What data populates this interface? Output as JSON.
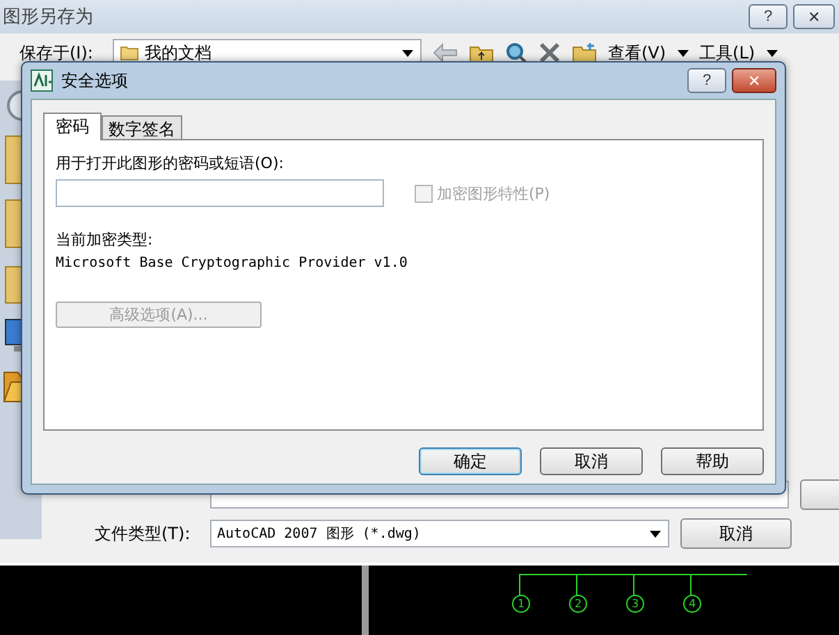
{
  "window": {
    "title": "图形另存为",
    "buttons": [
      {
        "kind": "help",
        "label": "?"
      },
      {
        "kind": "close",
        "label": "✕"
      }
    ]
  },
  "toolbar": {
    "save_in_label": "保存于(I):",
    "location": "我的文档",
    "view_menu": "查看(V)",
    "tools_menu": "工具(L)"
  },
  "file_type": {
    "label": "文件类型(T):",
    "value": "AutoCAD 2007 图形 (*.dwg)"
  },
  "cancel_button": "取消",
  "drawing_markers": [
    "1",
    "2",
    "3",
    "4"
  ],
  "dialog": {
    "title": "安全选项",
    "help": "?",
    "close": "✕",
    "tabs": [
      {
        "label": "密码",
        "selected": true
      },
      {
        "label": "数字签名",
        "selected": false
      }
    ],
    "password_label": "用于打开此图形的密码或短语(O):",
    "encrypt_properties": {
      "label": "加密图形特性(P)",
      "checked": false,
      "disabled": true
    },
    "encryption_type_label": "当前加密类型:",
    "encryption_type": "Microsoft Base Cryptographic Provider v1.0",
    "advanced": {
      "label": "高级选项(A)...",
      "disabled": true
    },
    "buttons": [
      {
        "label": "确定",
        "default": true
      },
      {
        "label": "取消",
        "default": false
      },
      {
        "label": "帮助",
        "default": false
      }
    ]
  }
}
